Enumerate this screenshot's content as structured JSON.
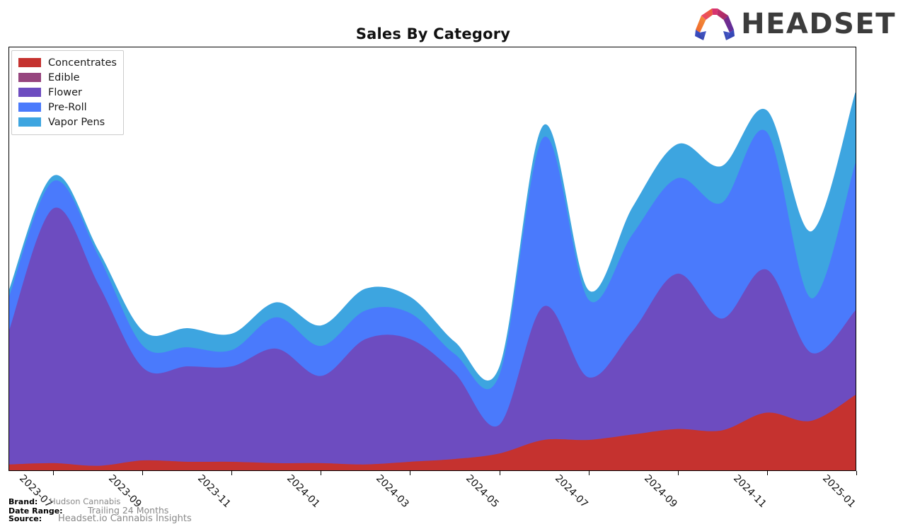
{
  "header": {
    "title": "Sales By Category",
    "logo_text": "HEADSET",
    "logo_icon": "headset-logo-icon"
  },
  "legend": {
    "position": "upper-left",
    "items": [
      {
        "label": "Concentrates",
        "color": "#c5322f"
      },
      {
        "label": "Edible",
        "color": "#96457e"
      },
      {
        "label": "Flower",
        "color": "#6d4cc0"
      },
      {
        "label": "Pre-Roll",
        "color": "#4a7afc"
      },
      {
        "label": "Vapor Pens",
        "color": "#3da5e0"
      }
    ]
  },
  "footer": {
    "rows": [
      {
        "key": "Brand:",
        "value": "Hudson Cannabis"
      },
      {
        "key": "Date Range:",
        "value": "Trailing 24 Months"
      },
      {
        "key": "Source:",
        "value": "Headset.io Cannabis Insights"
      }
    ]
  },
  "chart_data": {
    "type": "area",
    "stacked": true,
    "title": "Sales By Category",
    "xlabel": "",
    "ylabel": "",
    "grid": false,
    "legend_position": "upper-left",
    "axis": {
      "x_tick_labels": [
        "2023-07",
        "2023-09",
        "2023-11",
        "2024-01",
        "2024-03",
        "2024-05",
        "2024-07",
        "2024-09",
        "2024-11",
        "2025-01"
      ],
      "y_tick_labels": [],
      "y_axis_visible": false
    },
    "x": [
      "2023-06",
      "2023-07",
      "2023-08",
      "2023-09",
      "2023-10",
      "2023-11",
      "2023-12",
      "2024-01",
      "2024-02",
      "2024-03",
      "2024-04",
      "2024-05",
      "2024-06",
      "2024-07",
      "2024-08",
      "2024-09",
      "2024-10",
      "2024-11",
      "2024-12",
      "2025-01"
    ],
    "series": [
      {
        "name": "Concentrates",
        "color": "#c5322f",
        "values": [
          4,
          5,
          3,
          7,
          6,
          6,
          5,
          5,
          4,
          6,
          8,
          12,
          22,
          22,
          26,
          30,
          29,
          42,
          36,
          55
        ]
      },
      {
        "name": "Edible",
        "color": "#96457e",
        "values": [
          0,
          0,
          0,
          0,
          0,
          0,
          0,
          0,
          0,
          0,
          0,
          0,
          0,
          0,
          0,
          0,
          0,
          0,
          0,
          0
        ]
      },
      {
        "name": "Flower",
        "color": "#6d4cc0",
        "values": [
          98,
          187,
          133,
          68,
          70,
          70,
          84,
          64,
          92,
          90,
          63,
          21,
          98,
          46,
          76,
          114,
          82,
          105,
          50,
          62
        ]
      },
      {
        "name": "Pre-Roll",
        "color": "#4a7afc",
        "values": [
          25,
          20,
          21,
          16,
          14,
          12,
          23,
          22,
          21,
          19,
          14,
          36,
          124,
          57,
          71,
          70,
          85,
          101,
          40,
          108
        ]
      },
      {
        "name": "Vapor Pens",
        "color": "#3da5e0",
        "values": [
          5,
          4,
          4,
          11,
          14,
          12,
          11,
          15,
          16,
          12,
          9,
          6,
          9,
          7,
          20,
          25,
          27,
          16,
          49,
          52
        ]
      }
    ],
    "notes": "Stacked area chart; Edible series is effectively zero across the full range. Values are relative sales units estimated from plotted heights."
  }
}
